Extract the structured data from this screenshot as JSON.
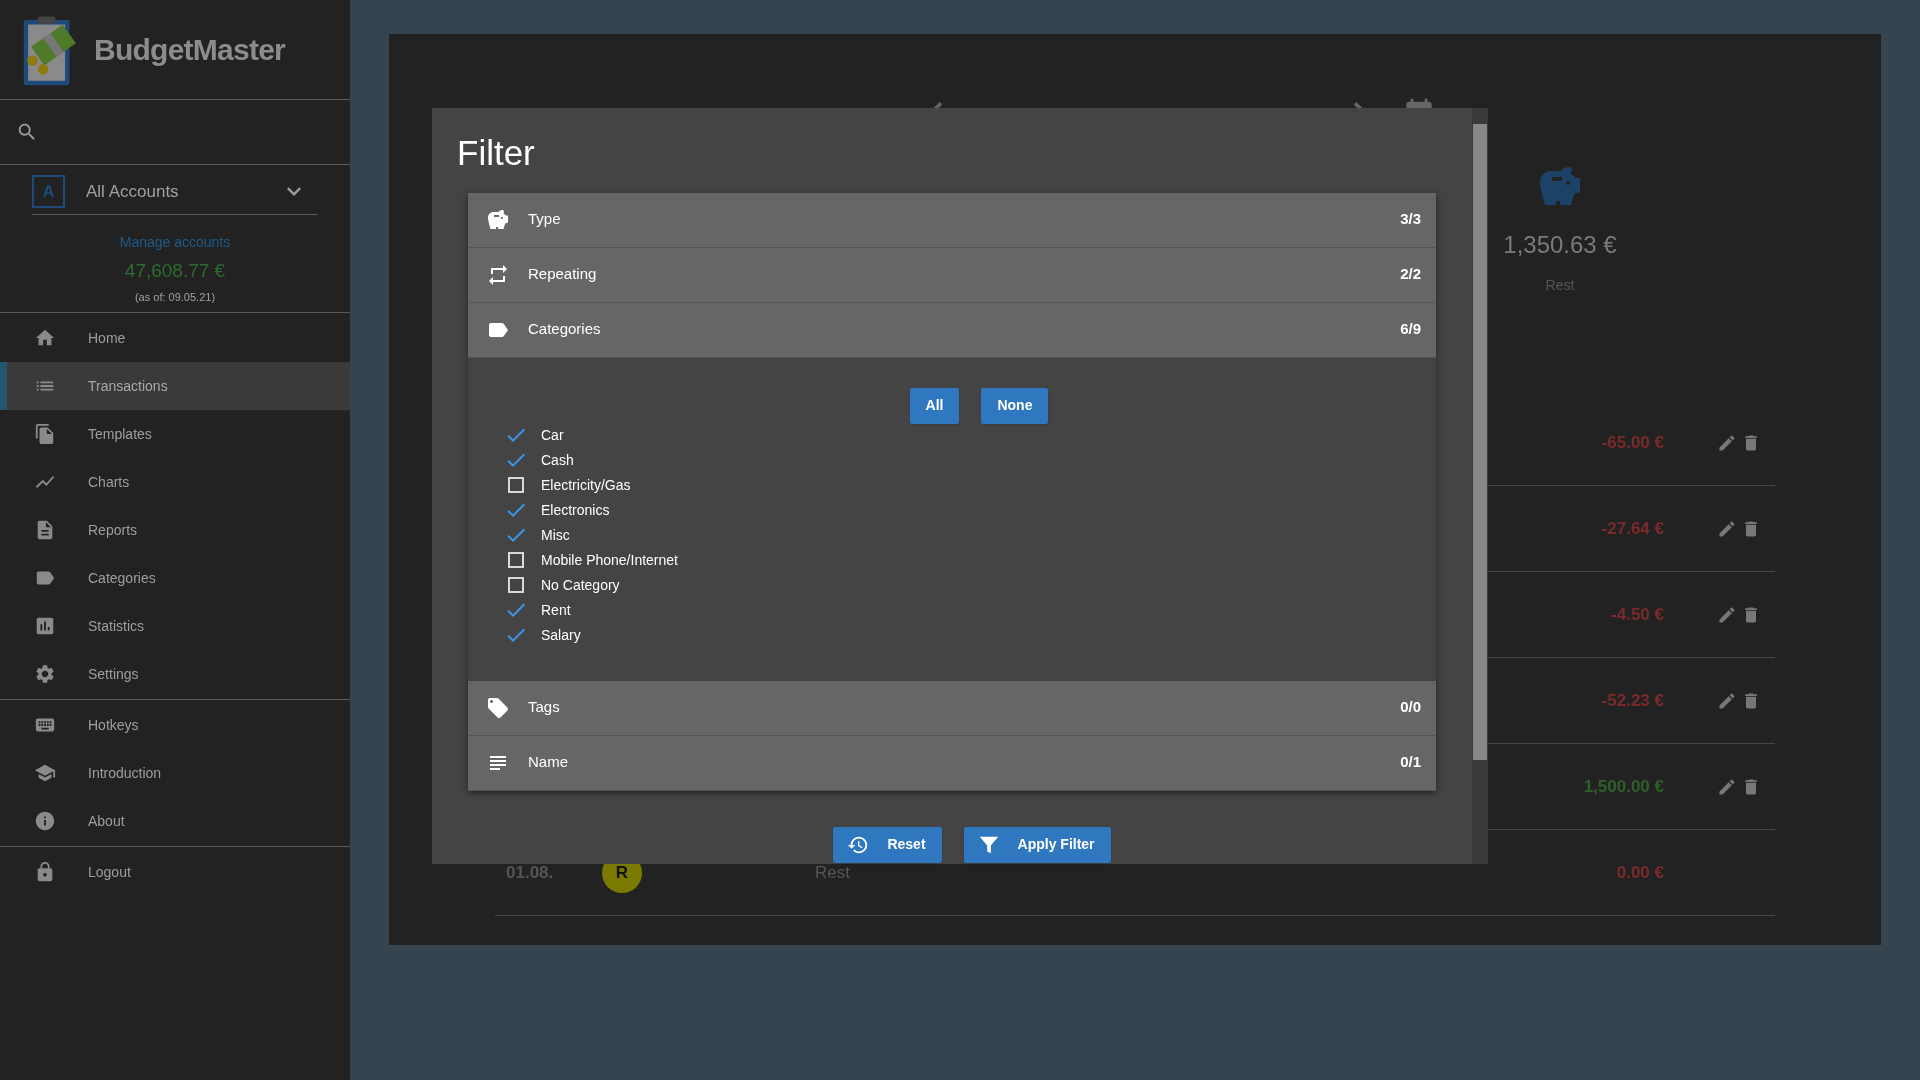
{
  "sidebar": {
    "app_name": "BudgetMaster",
    "account": {
      "badge": "A",
      "label": "All Accounts"
    },
    "manage_link": "Manage accounts",
    "balance": "47,608.77 €",
    "as_of": "(as of: 09.05.21)",
    "nav_groups": [
      {
        "items": [
          {
            "label": "Home",
            "selected": false
          },
          {
            "label": "Transactions",
            "selected": true
          },
          {
            "label": "Templates",
            "selected": false
          },
          {
            "label": "Charts",
            "selected": false
          },
          {
            "label": "Reports",
            "selected": false
          },
          {
            "label": "Categories",
            "selected": false
          },
          {
            "label": "Statistics",
            "selected": false
          },
          {
            "label": "Settings",
            "selected": false
          }
        ]
      },
      {
        "items": [
          {
            "label": "Hotkeys",
            "selected": false
          },
          {
            "label": "Introduction",
            "selected": false
          },
          {
            "label": "About",
            "selected": false
          }
        ]
      },
      {
        "items": [
          {
            "label": "Logout",
            "selected": false
          }
        ]
      }
    ]
  },
  "background": {
    "summary": {
      "amount": "1,350.63 €",
      "label": "Rest"
    },
    "transactions": [
      {
        "amount": "-65.00 €",
        "color": "#7a2a2a",
        "actions": true
      },
      {
        "amount": "-27.64 €",
        "color": "#7a2a2a",
        "actions": true
      },
      {
        "amount": "-4.50 €",
        "color": "#7a2a2a",
        "actions": true
      },
      {
        "amount": "-52.23 €",
        "color": "#7a2a2a",
        "actions": true
      },
      {
        "amount": "1,500.00 €",
        "color": "#2f5f2a",
        "actions": true
      },
      {
        "date": "01.08.",
        "badge": "R",
        "name": "Rest",
        "amount": "0.00 €",
        "color": "#7a2a2a",
        "actions": false
      }
    ]
  },
  "filter_dialog": {
    "title": "Filter",
    "sections": [
      {
        "label": "Type",
        "count": "3/3"
      },
      {
        "label": "Repeating",
        "count": "2/2"
      },
      {
        "label": "Categories",
        "count": "6/9",
        "buttons": [
          "All",
          "None"
        ],
        "options": [
          {
            "label": "Car",
            "checked": true
          },
          {
            "label": "Cash",
            "checked": true
          },
          {
            "label": "Electricity/Gas",
            "checked": false
          },
          {
            "label": "Electronics",
            "checked": true
          },
          {
            "label": "Misc",
            "checked": true
          },
          {
            "label": "Mobile Phone/Internet",
            "checked": false
          },
          {
            "label": "No Category",
            "checked": false
          },
          {
            "label": "Rent",
            "checked": true
          },
          {
            "label": "Salary",
            "checked": true
          }
        ]
      },
      {
        "label": "Tags",
        "count": "0/0"
      },
      {
        "label": "Name",
        "count": "0/1"
      }
    ],
    "footer_buttons": [
      "Reset",
      "Apply Filter"
    ]
  }
}
